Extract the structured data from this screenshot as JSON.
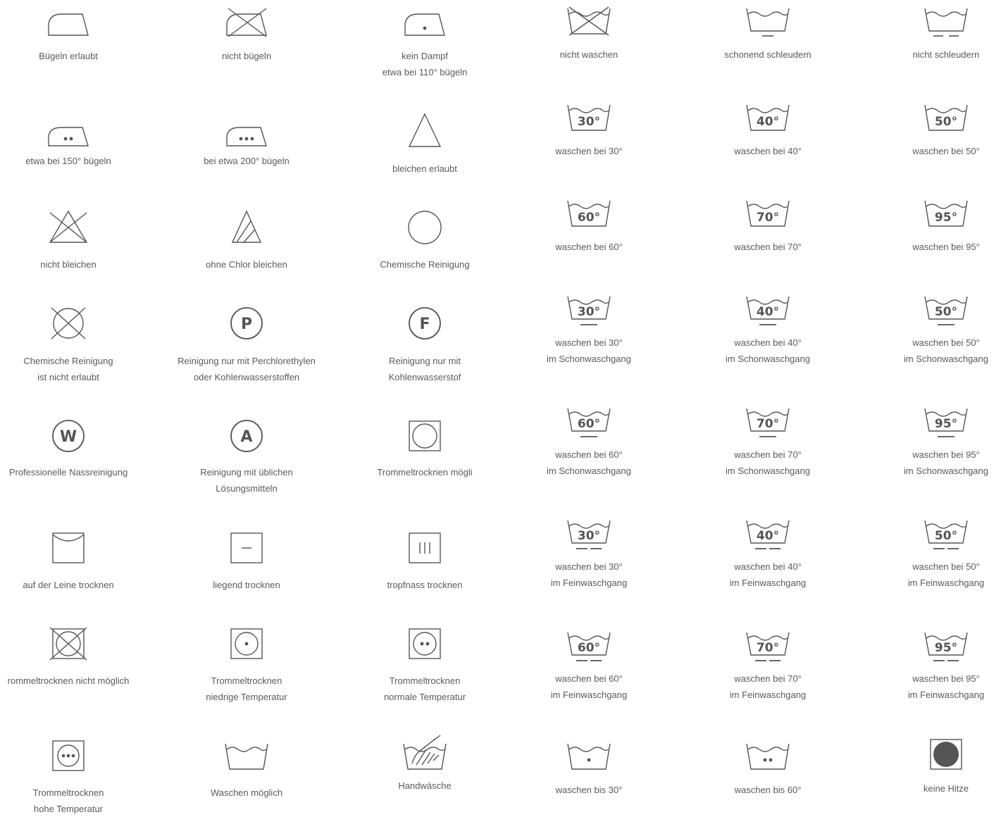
{
  "symbols": {
    "iron_allowed": {
      "label1": "Bügeln erlaubt",
      "label2": ""
    },
    "no_iron": {
      "label1": "nicht bügeln",
      "label2": ""
    },
    "no_steam": {
      "label1": "kein Dampf",
      "label2": "etwa bei 110° bügeln"
    },
    "no_wash": {
      "label1": "nicht waschen",
      "label2": ""
    },
    "gentle_spin": {
      "label1": "schonend schleudern",
      "label2": ""
    },
    "no_spin": {
      "label1": "nicht schleudern",
      "label2": ""
    },
    "iron_150": {
      "label1": "etwa bei 150° bügeln",
      "label2": ""
    },
    "iron_200": {
      "label1": "bei etwa 200° bügeln",
      "label2": ""
    },
    "bleach_allowed": {
      "label1": "bleichen erlaubt",
      "label2": ""
    },
    "wash30": {
      "deg": "30°",
      "label1": "waschen bei 30°",
      "label2": ""
    },
    "wash40": {
      "deg": "40°",
      "label1": "waschen bei 40°",
      "label2": ""
    },
    "wash50": {
      "deg": "50°",
      "label1": "waschen bei 50°",
      "label2": ""
    },
    "no_bleach": {
      "label1": "nicht bleichen",
      "label2": ""
    },
    "no_chlorine": {
      "label1": "ohne Chlor bleichen",
      "label2": ""
    },
    "dry_clean": {
      "label1": "Chemische Reinigung",
      "label2": ""
    },
    "wash60": {
      "deg": "60°",
      "label1": "waschen bei 60°",
      "label2": ""
    },
    "wash70": {
      "deg": "70°",
      "label1": "waschen bei 70°",
      "label2": ""
    },
    "wash95": {
      "deg": "95°",
      "label1": "waschen bei 95°",
      "label2": ""
    },
    "no_dry_clean": {
      "label1": "Chemische Reinigung",
      "label2": "ist nicht erlaubt"
    },
    "clean_p": {
      "letter": "P",
      "label1": "Reinigung nur mit Perchlorethylen",
      "label2": "oder Kohlenwasserstoffen"
    },
    "clean_f": {
      "letter": "F",
      "label1": "Reinigung nur mit",
      "label2": "Kohlenwasserstof"
    },
    "gentle30": {
      "deg": "30°",
      "label1": "waschen bei 30°",
      "label2": "im Schonwaschgang"
    },
    "gentle40": {
      "deg": "40°",
      "label1": "waschen bei 40°",
      "label2": "im Schonwaschgang"
    },
    "gentle50": {
      "deg": "50°",
      "label1": "waschen bei 50°",
      "label2": "im Schonwaschgang"
    },
    "wet_clean": {
      "letter": "W",
      "label1": "Professionelle Nassreinigung",
      "label2": ""
    },
    "clean_a": {
      "letter": "A",
      "label1": "Reinigung mit üblichen",
      "label2": "Lösungsmitteln"
    },
    "tumble_ok": {
      "label1": "Trommeltrocknen mögli",
      "label2": ""
    },
    "gentle60": {
      "deg": "60°",
      "label1": "waschen bei 60°",
      "label2": "im Schonwaschgang"
    },
    "gentle70": {
      "deg": "70°",
      "label1": "waschen bei 70°",
      "label2": "im Schonwaschgang"
    },
    "gentle95": {
      "deg": "95°",
      "label1": "waschen bei 95°",
      "label2": "im Schonwaschgang"
    },
    "line_dry": {
      "label1": "auf der Leine trocknen",
      "label2": ""
    },
    "flat_dry": {
      "label1": "liegend trocknen",
      "label2": ""
    },
    "drip_dry": {
      "label1": "tropfnass trocknen",
      "label2": ""
    },
    "delicate30": {
      "deg": "30°",
      "label1": "waschen bei 30°",
      "label2": "im Feinwaschgang"
    },
    "delicate40": {
      "deg": "40°",
      "label1": "waschen bei 40°",
      "label2": "im Feinwaschgang"
    },
    "delicate50": {
      "deg": "50°",
      "label1": "waschen bei 50°",
      "label2": "im Feinwaschgang"
    },
    "no_tumble": {
      "label1": "rommeltrocknen nicht möglich",
      "label2": ""
    },
    "tumble_low": {
      "label1": "Trommeltrocknen",
      "label2": "niedrige Temperatur"
    },
    "tumble_normal": {
      "label1": "Trommeltrocknen",
      "label2": "normale Temperatur"
    },
    "delicate60": {
      "deg": "60°",
      "label1": "waschen bei 60°",
      "label2": "im Feinwaschgang"
    },
    "delicate70": {
      "deg": "70°",
      "label1": "waschen bei 70°",
      "label2": "im Feinwaschgang"
    },
    "delicate95": {
      "deg": "95°",
      "label1": "waschen bei 95°",
      "label2": "im Feinwaschgang"
    },
    "tumble_high": {
      "label1": "Trommeltrocknen",
      "label2": "hohe Temperatur"
    },
    "wash_ok": {
      "label1": "Waschen möglich",
      "label2": ""
    },
    "hand_wash": {
      "label1": "Handwäsche",
      "label2": ""
    },
    "wash_upto30": {
      "label1": "waschen bis 30°",
      "label2": ""
    },
    "wash_upto60": {
      "label1": "waschen bis 60°",
      "label2": ""
    },
    "no_heat": {
      "label1": "keine Hitze",
      "label2": ""
    }
  }
}
